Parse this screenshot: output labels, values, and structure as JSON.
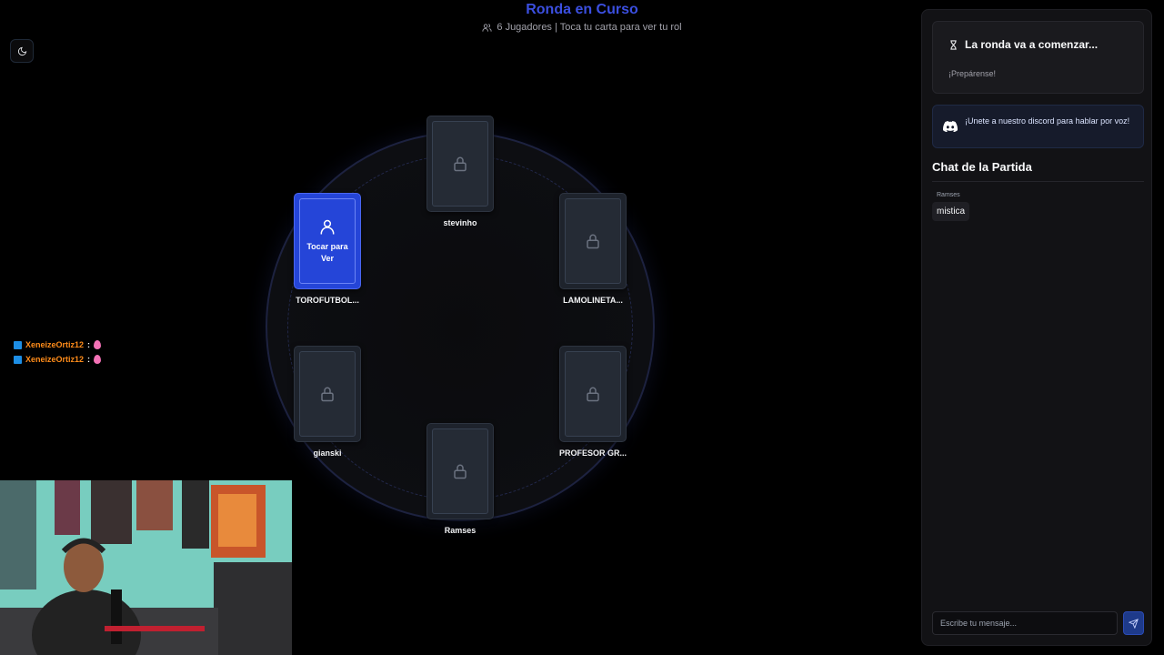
{
  "header": {
    "title": "Ronda en Curso",
    "subtitle": "6 Jugadores | Toca tu carta para ver tu rol"
  },
  "theme_toggle": {
    "icon": "moon-icon"
  },
  "players": [
    {
      "name": "stevinho",
      "state": "locked"
    },
    {
      "name": "TOROFUTBOL...",
      "state": "own",
      "card_label": "Tocar para Ver"
    },
    {
      "name": "LAMOLINETA...",
      "state": "locked"
    },
    {
      "name": "gianski",
      "state": "locked"
    },
    {
      "name": "PROFESOR GR...",
      "state": "locked"
    },
    {
      "name": "Ramses",
      "state": "locked"
    }
  ],
  "twitch_overlay": {
    "lines": [
      {
        "user": "XeneizeOrtiz12",
        "sep": ":"
      },
      {
        "user": "XeneizeOrtiz12",
        "sep": ":"
      }
    ]
  },
  "sidebar": {
    "round_status": {
      "title": "La ronda va a comenzar...",
      "subtitle": "¡Prepárense!",
      "icon": "hourglass-icon"
    },
    "discord": {
      "text": "¡Unete a nuestro discord para hablar por voz!",
      "icon": "discord-icon"
    },
    "chat": {
      "title": "Chat de la Partida",
      "messages": [
        {
          "user": "Ramses",
          "text": "mistica"
        }
      ],
      "input_placeholder": "Escribe tu mensaje...",
      "send_icon": "send-icon"
    }
  },
  "colors": {
    "accent": "#3b4fe0",
    "own_card": "#2545d8",
    "panel": "#121215",
    "twitch_user": "#ff8c1a"
  }
}
